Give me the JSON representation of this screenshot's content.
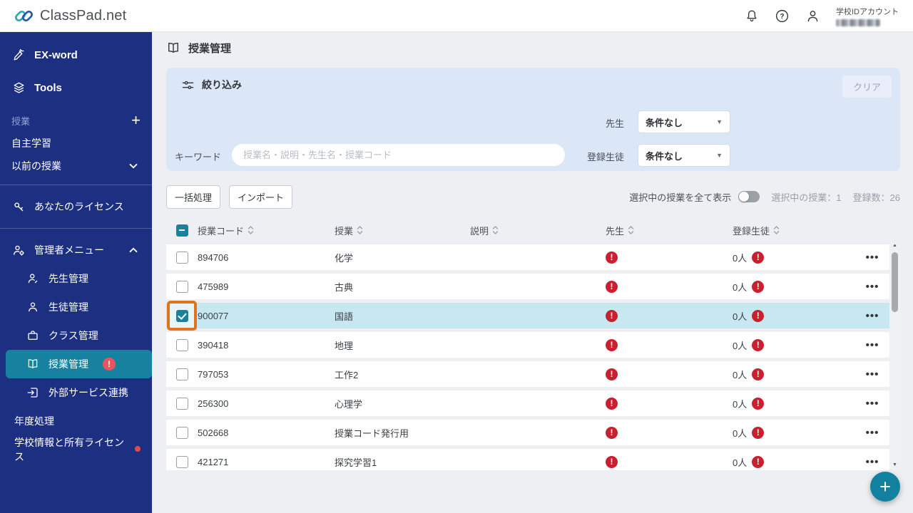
{
  "header": {
    "logo_text": "ClassPad.net",
    "account_label": "学校IDアカウント"
  },
  "sidebar": {
    "exword": "EX-word",
    "tools": "Tools",
    "group_label": "授業",
    "self_study": "自主学習",
    "previous_classes": "以前の授業",
    "your_license": "あなたのライセンス",
    "admin_menu": "管理者メニュー",
    "teacher_mgmt": "先生管理",
    "student_mgmt": "生徒管理",
    "class_mgmt": "クラス管理",
    "lesson_mgmt": "授業管理",
    "lesson_badge": "!",
    "external_services": "外部サービス連携",
    "year_processing": "年度処理",
    "school_info": "学校情報と所有ライセンス"
  },
  "page": {
    "title": "授業管理"
  },
  "filter": {
    "title": "絞り込み",
    "clear_label": "クリア",
    "teacher_label": "先生",
    "teacher_value": "条件なし",
    "keyword_label": "キーワード",
    "keyword_placeholder": "授業名・説明・先生名・授業コード",
    "students_label": "登録生徒",
    "students_value": "条件なし"
  },
  "toolbar": {
    "bulk_label": "一括処理",
    "import_label": "インポート",
    "show_selected_label": "選択中の授業を全て表示",
    "selected_count_label": "選択中の授業：1",
    "registered_count_label": "登録数：26"
  },
  "table": {
    "columns": [
      "授業コード",
      "授業",
      "説明",
      "先生",
      "登録生徒"
    ],
    "alert_glyph": "!",
    "menu_glyph": "•••",
    "rows": [
      {
        "code": "894706",
        "name": "化学",
        "students": "0人"
      },
      {
        "code": "475989",
        "name": "古典",
        "students": "0人"
      },
      {
        "code": "900077",
        "name": "国語",
        "students": "0人",
        "selected": true,
        "highlight": true
      },
      {
        "code": "390418",
        "name": "地理",
        "students": "0人"
      },
      {
        "code": "797053",
        "name": "工作2",
        "students": "0人"
      },
      {
        "code": "256300",
        "name": "心理学",
        "students": "0人"
      },
      {
        "code": "502668",
        "name": "授業コード発行用",
        "students": "0人"
      },
      {
        "code": "421271",
        "name": "探究学習1",
        "students": "0人"
      }
    ]
  },
  "colors": {
    "sidebar_navy": "#1d2f80",
    "active_teal": "#17829f",
    "alert_red": "#c8202f",
    "sidebar_badge_coral": "#e8555c",
    "selected_row": "#c7e8f0",
    "highlight_orange": "#e0731d",
    "filter_panel_blue": "#dbe6f6",
    "fab_teal": "#11819f"
  }
}
